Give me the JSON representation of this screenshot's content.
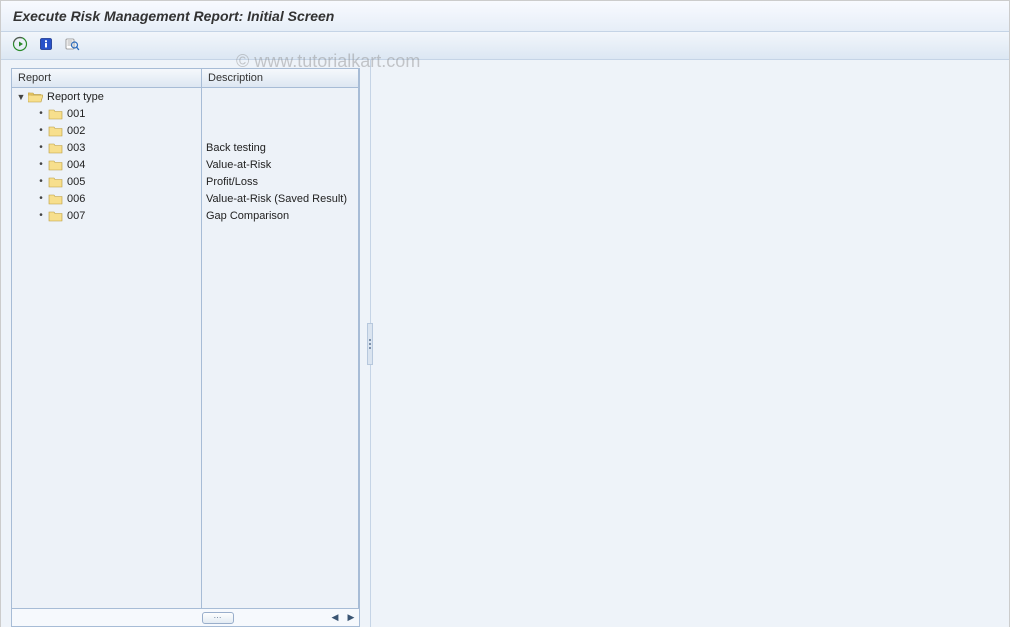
{
  "window": {
    "title": "Execute Risk Management Report: Initial Screen"
  },
  "toolbar": {
    "execute_icon": "execute",
    "info_icon": "info",
    "config_icon": "config"
  },
  "tree": {
    "columns": {
      "report": "Report",
      "description": "Description"
    },
    "root": {
      "label": "Report type",
      "expanded": true
    },
    "items": [
      {
        "label": "001",
        "description": ""
      },
      {
        "label": "002",
        "description": ""
      },
      {
        "label": "003",
        "description": "Back testing"
      },
      {
        "label": "004",
        "description": "Value-at-Risk"
      },
      {
        "label": "005",
        "description": "Profit/Loss"
      },
      {
        "label": "006",
        "description": "Value-at-Risk (Saved Result)"
      },
      {
        "label": "007",
        "description": "Gap Comparison"
      }
    ]
  },
  "watermark": "© www.tutorialkart.com"
}
